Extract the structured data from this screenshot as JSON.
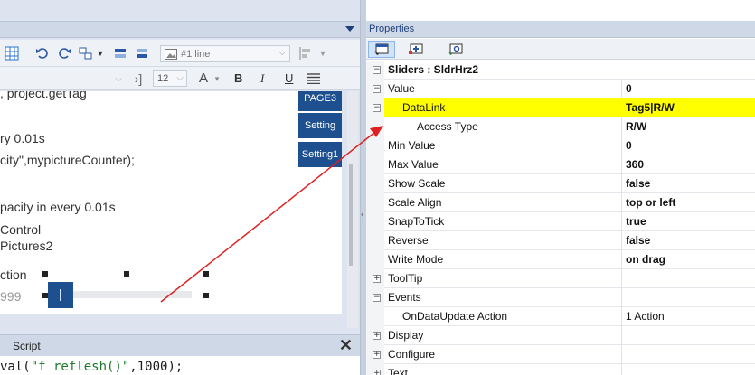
{
  "toolbar": {
    "line_style": "#1 line",
    "font_size": "12",
    "bold": "B",
    "italic": "I",
    "underline": "U"
  },
  "editor": {
    "lines": [
      ", project.getTag",
      "ry 0.01s",
      "city\",mypictureCounter);",
      "pacity in every 0.01s",
      " Control",
      "Pictures2",
      "ction",
      "999"
    ],
    "page_buttons": [
      "PAGE3",
      "Setting",
      "Setting1"
    ]
  },
  "script_panel": {
    "tab": "Script",
    "close": "✕",
    "code_prefix": "val(",
    "code_string": "\"f reflesh()\"",
    "code_suffix": ",1000);"
  },
  "properties": {
    "title": "Properties",
    "object": "Sliders : SldrHrz2",
    "rows": [
      {
        "name": "Value",
        "value": "0",
        "expander": "−"
      },
      {
        "name": "DataLink",
        "value": "Tag5|R/W",
        "expander": "−"
      },
      {
        "name": "Access Type",
        "value": "R/W",
        "expander": ""
      },
      {
        "name": "Min Value",
        "value": "0",
        "expander": ""
      },
      {
        "name": "Max Value",
        "value": "360",
        "expander": ""
      },
      {
        "name": "Show Scale",
        "value": "false",
        "expander": ""
      },
      {
        "name": "Scale Align",
        "value": "top or left",
        "expander": ""
      },
      {
        "name": "SnapToTick",
        "value": "true",
        "expander": ""
      },
      {
        "name": "Reverse",
        "value": "false",
        "expander": ""
      },
      {
        "name": "Write Mode",
        "value": "on drag",
        "expander": ""
      },
      {
        "name": "ToolTip",
        "value": "",
        "expander": "+"
      },
      {
        "name": "Events",
        "value": "",
        "expander": "−"
      },
      {
        "name": "OnDataUpdate Action",
        "value": "1 Action",
        "expander": ""
      },
      {
        "name": "Display",
        "value": "",
        "expander": "+"
      },
      {
        "name": "Configure",
        "value": "",
        "expander": "+"
      },
      {
        "name": "Text",
        "value": "",
        "expander": "+"
      }
    ],
    "header_expander": "−"
  },
  "colors": {
    "accent": "#1e4f8f",
    "highlight": "#ffff00",
    "arrow": "#e02020"
  }
}
